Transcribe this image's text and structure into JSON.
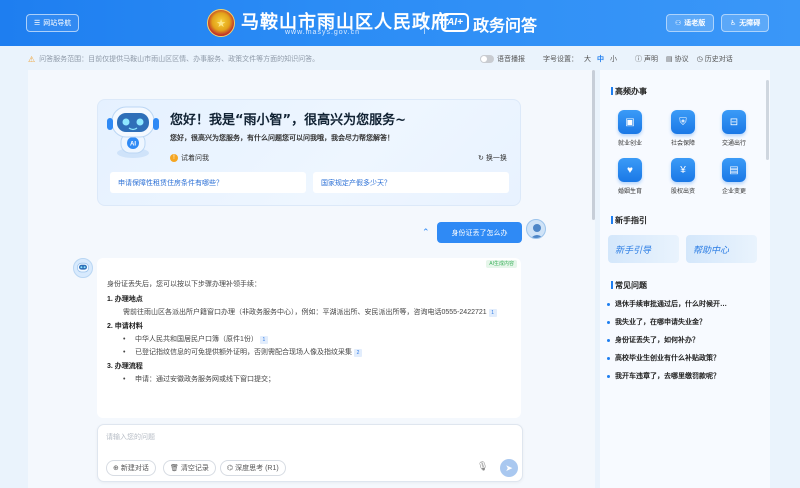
{
  "header": {
    "nav_label": "网站导航",
    "gov_name": "马鞍山市雨山区人民政府",
    "url": "www.masys.gov.cn",
    "ai_badge": "AI+",
    "product": "政务问答",
    "elderly_mode": "适老版",
    "accessibility": "无障碍"
  },
  "notice": {
    "text": "问答服务范围：目前仅提供马鞍山市雨山区区情、办事服务、政策文件等方面的知识问答。"
  },
  "settings": {
    "voice_label": "语音播报",
    "font_label": "字号设置：",
    "font_sizes": [
      "大",
      "中",
      "小"
    ],
    "active_font": "中",
    "statement": "声明",
    "agreement": "协议",
    "history": "历史对话"
  },
  "welcome": {
    "title": "您好！我是“雨小智”，很高兴为您服务~",
    "subtitle": "您好，很高兴为您服务，有什么问题您可以问我哦，我会尽力帮您解答！",
    "try_ask": "试着问我",
    "refresh": "换一换",
    "suggestions": [
      "申请保障性租赁住房条件有哪些？",
      "国家规定产假多少天？"
    ]
  },
  "conversation": {
    "user_question": "身份证丢了怎么办",
    "ai_tag": "AI生成内容",
    "intro": "身份证丢失后，您可以按以下步骤办理补领手续：",
    "sections": [
      {
        "title": "1. 办理地点",
        "body": "需前往雨山区各派出所户籍窗口办理（非政务服务中心），例如：平湖派出所、安民派出所等，咨询电话0555-2422721",
        "ref": "1"
      },
      {
        "title": "2. 申请材料",
        "bullets": [
          {
            "text": "中华人民共和国居民户口簿（原件1份）",
            "ref": "1"
          },
          {
            "text": "已登记指纹信息的可免提供额外证明，否则需配合现场人像及指纹采集",
            "ref": "2"
          }
        ]
      },
      {
        "title": "3. 办理流程",
        "bullets": [
          {
            "text": "申请：通过安徽政务服务网或线下窗口提交；",
            "ref": ""
          }
        ]
      }
    ]
  },
  "input": {
    "placeholder": "请输入您的问题",
    "new_chat": "新建对话",
    "clear": "清空记录",
    "deep_think": "深度思考 (R1)"
  },
  "sidebar": {
    "services_title": "高频办事",
    "services": [
      {
        "label": "就业创业",
        "icon": "briefcase-icon"
      },
      {
        "label": "社会保障",
        "icon": "shield-icon"
      },
      {
        "label": "交通出行",
        "icon": "bus-icon"
      },
      {
        "label": "婚姻生育",
        "icon": "heart-icon"
      },
      {
        "label": "股权出资",
        "icon": "money-icon"
      },
      {
        "label": "企业变更",
        "icon": "document-icon"
      }
    ],
    "guide_title": "新手指引",
    "guide_cards": [
      "新手引导",
      "帮助中心"
    ],
    "faq_title": "常见问题",
    "faqs": [
      "退休手续审批通过后，什么时候开…",
      "我失业了，在哪申请失业金？",
      "身份证丢失了，如何补办？",
      "高校毕业生创业有什么补贴政策？",
      "我开车违章了，去哪里缴罚款呢？"
    ]
  }
}
